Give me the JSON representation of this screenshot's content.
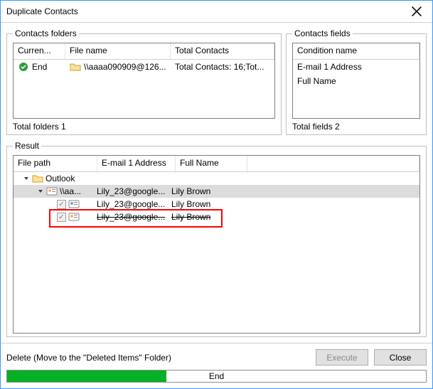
{
  "window": {
    "title": "Duplicate Contacts"
  },
  "folders": {
    "legend": "Contacts folders",
    "cols": {
      "c1": "Curren...",
      "c2": "File name",
      "c3": "Total Contacts"
    },
    "row": {
      "c1": "End",
      "c2": "\\\\aaaa090909@126...",
      "c3": "Total Contacts: 16;Tot..."
    },
    "total": "Total folders  1"
  },
  "fields": {
    "legend": "Contacts fields",
    "header": "Condition name",
    "rows": [
      "E-mail 1 Address",
      "Full Name"
    ],
    "total": "Total fields  2"
  },
  "result": {
    "legend": "Result",
    "cols": {
      "c1": "File path",
      "c2": "E-mail 1 Address",
      "c3": "Full Name"
    },
    "tree": {
      "root": "Outlook",
      "node1": "\\\\aa...",
      "rows": [
        {
          "email": "Lily_23@google...",
          "name": "Lily Brown",
          "strike": false
        },
        {
          "email": "Lily_23@google...",
          "name": "Lily Brown",
          "strike": false
        },
        {
          "email": "Lily_23@google...",
          "name": "Lily Brown",
          "strike": true
        }
      ]
    }
  },
  "footer": {
    "status": "Delete (Move to the \"Deleted Items\" Folder)",
    "execute": "Execute",
    "close": "Close",
    "progress": "End"
  }
}
